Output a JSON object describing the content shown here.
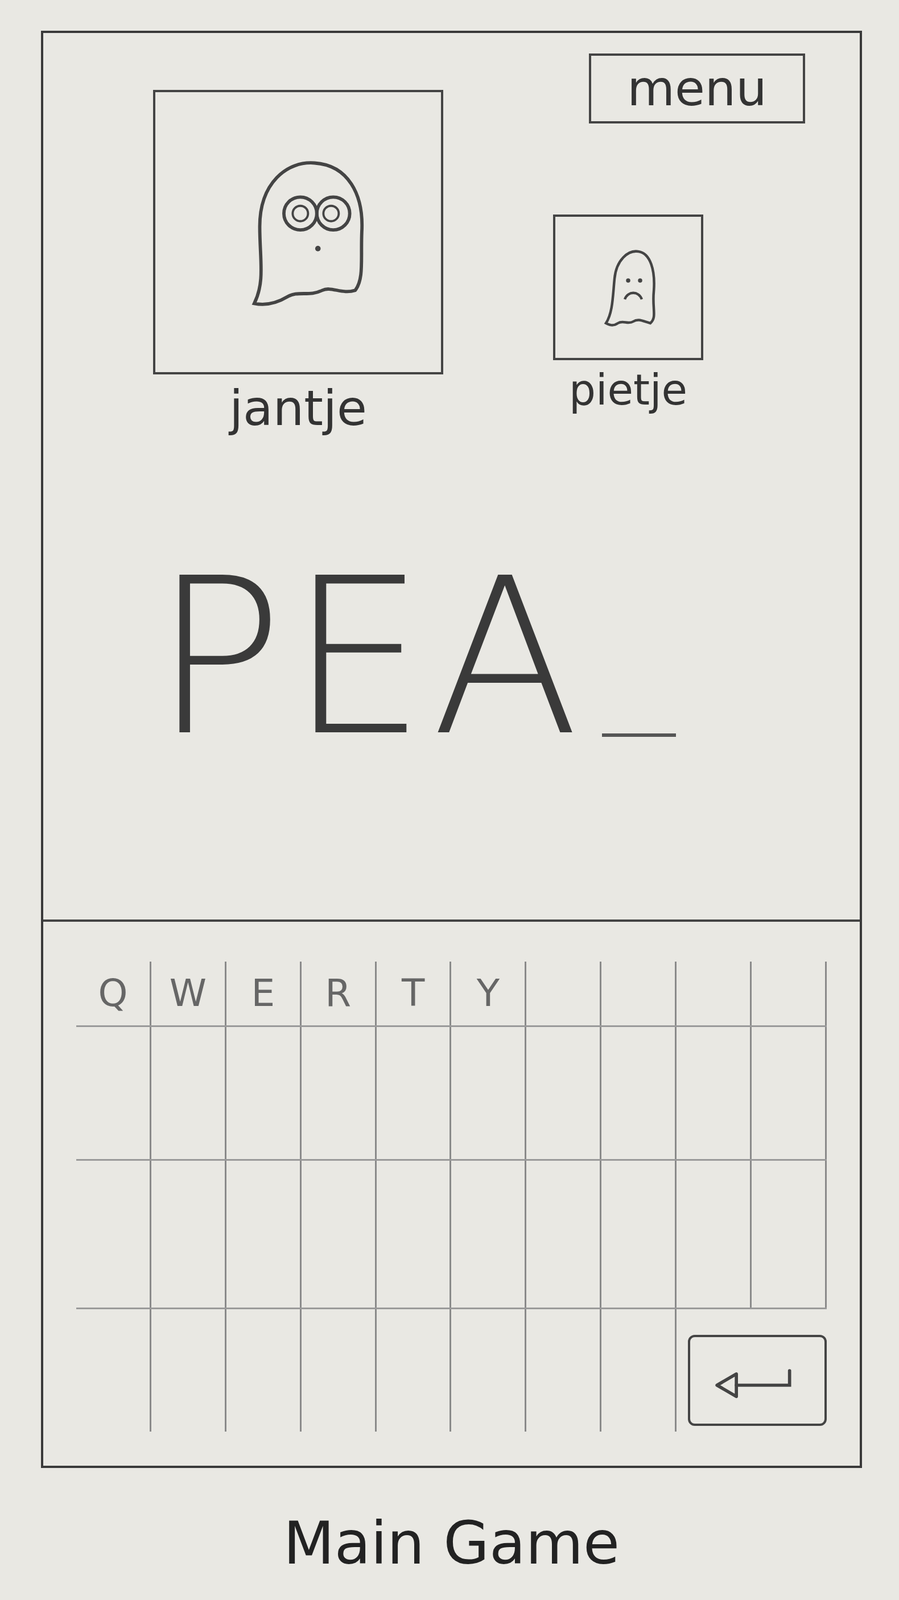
{
  "screen": {
    "caption": "Main Game"
  },
  "menu_button": {
    "label": "menu"
  },
  "players": [
    {
      "name": "jantje",
      "active": true
    },
    {
      "name": "pietje",
      "active": false
    }
  ],
  "word": {
    "letters": "PEA",
    "blank_slots": 1
  },
  "keyboard": {
    "rows": [
      {
        "keys": [
          {
            "kind": "letter",
            "label": "Q"
          },
          {
            "kind": "letter",
            "label": "W"
          },
          {
            "kind": "letter",
            "label": "E"
          },
          {
            "kind": "letter",
            "label": "R"
          },
          {
            "kind": "letter",
            "label": "T"
          },
          {
            "kind": "letter",
            "label": "Y"
          },
          {
            "kind": "blank"
          },
          {
            "kind": "blank"
          },
          {
            "kind": "blank"
          },
          {
            "kind": "blank"
          }
        ]
      },
      {
        "keys": [
          {
            "kind": "blank"
          },
          {
            "kind": "blank"
          },
          {
            "kind": "blank"
          },
          {
            "kind": "blank"
          },
          {
            "kind": "blank"
          },
          {
            "kind": "blank"
          },
          {
            "kind": "blank"
          },
          {
            "kind": "blank"
          },
          {
            "kind": "blank"
          },
          {
            "kind": "blank"
          }
        ]
      },
      {
        "keys": [
          {
            "kind": "blank"
          },
          {
            "kind": "blank"
          },
          {
            "kind": "blank"
          },
          {
            "kind": "blank"
          },
          {
            "kind": "blank"
          },
          {
            "kind": "blank"
          },
          {
            "kind": "blank"
          },
          {
            "kind": "blank"
          },
          {
            "kind": "blank"
          },
          {
            "kind": "blank"
          }
        ]
      },
      {
        "keys": [
          {
            "kind": "blank"
          },
          {
            "kind": "blank"
          },
          {
            "kind": "blank"
          },
          {
            "kind": "blank"
          },
          {
            "kind": "blank"
          },
          {
            "kind": "blank"
          },
          {
            "kind": "blank"
          },
          {
            "kind": "blank"
          },
          {
            "kind": "backspace"
          }
        ]
      }
    ]
  }
}
